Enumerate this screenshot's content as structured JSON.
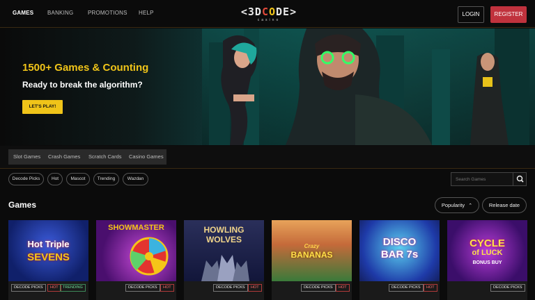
{
  "nav": {
    "items": [
      "GAMES",
      "BANKING",
      "PROMOTIONS",
      "HELP"
    ],
    "login": "LOGIN",
    "register": "REGISTER"
  },
  "logo": {
    "part1": "<3D",
    "part2": "C",
    "part3": "O",
    "part4": "DE>",
    "sub": "casino"
  },
  "hero": {
    "title": "1500+ Games & Counting",
    "subtitle": "Ready to break the algorithm?",
    "cta": "LET'S PLAY!"
  },
  "categories": [
    "Slot Games",
    "Crash Games",
    "Scratch Cards",
    "Casino Games"
  ],
  "filters": [
    "Decode Picks",
    "Hot",
    "Mascot",
    "Trending",
    "Wazdan"
  ],
  "search": {
    "placeholder": "Search Games"
  },
  "games_section": {
    "title": "Games",
    "sort_popularity": "Popularity",
    "sort_release": "Release date"
  },
  "games": [
    {
      "title_lines": [
        "Hot Triple",
        "SEVENS"
      ],
      "tags": [
        "DECODE PICKS",
        "HOT",
        "TRENDING"
      ]
    },
    {
      "title_lines": [
        "SHOWMASTER"
      ],
      "tags": [
        "DECODE PICKS",
        "HOT"
      ]
    },
    {
      "title_lines": [
        "HOWLING",
        "WOLVES"
      ],
      "tags": [
        "DECODE PICKS",
        "HOT"
      ]
    },
    {
      "title_lines": [
        "Crazy",
        "BANANAS"
      ],
      "tags": [
        "DECODE PICKS",
        "HOT"
      ]
    },
    {
      "title_lines": [
        "DISCO",
        "BAR 7s"
      ],
      "tags": [
        "DECODE PICKS",
        "HOT"
      ]
    },
    {
      "title_lines": [
        "CYCLE",
        "of LUCK",
        "BONUS BUY"
      ],
      "tags": [
        "DECODE PICKS"
      ]
    }
  ],
  "colors": {
    "accent": "#f0c419",
    "register": "#c0323d",
    "hot": "#ff6b6b",
    "trending": "#6fe09a"
  }
}
